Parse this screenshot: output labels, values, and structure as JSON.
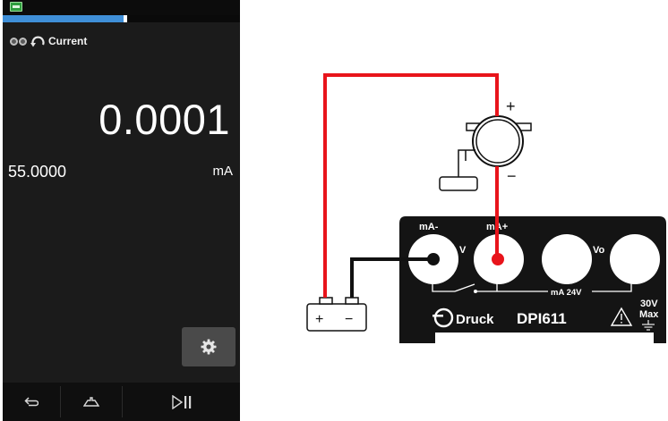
{
  "device": {
    "channel_label": "Current",
    "reading": "0.0001",
    "setpoint": "55.0000",
    "unit": "mA",
    "progress_percent": 51,
    "icons": {
      "battery": "battery-icon",
      "channel_status": "channel-dots-icon",
      "loop": "loop-arrow-icon",
      "settings": "gear-icon",
      "back": "back-arrow-icon",
      "home": "home-icon",
      "play_pause": "play-pause-icon"
    }
  },
  "diagram": {
    "terminal_labels": {
      "ma_minus": "mA-",
      "ma_plus": "mA+",
      "v": "V",
      "vo": "Vo",
      "ma_24v": "mA 24V",
      "max_voltage": "30V",
      "max_word": "Max"
    },
    "brand": "Druck",
    "model": "DPI611",
    "meter_plus": "+",
    "meter_minus": "−",
    "battery_plus": "+",
    "battery_minus": "−"
  },
  "colors": {
    "screen_bg": "#1b1b1b",
    "progress_fill": "#3f8fd8",
    "wire_red": "#e8141b",
    "wire_black": "#111111",
    "panel": "#141414"
  }
}
